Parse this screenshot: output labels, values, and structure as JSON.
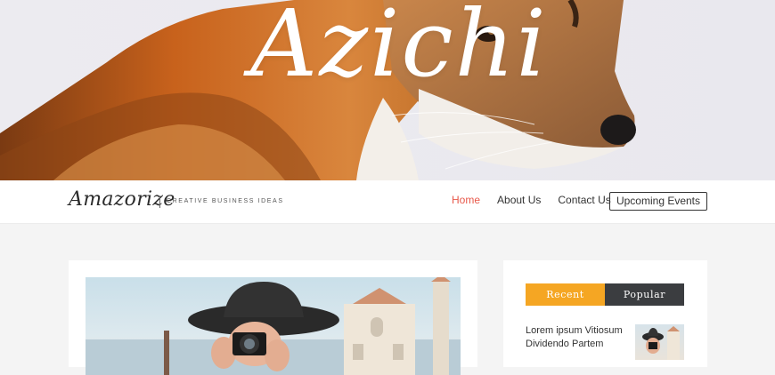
{
  "hero": {
    "title": "Azichi"
  },
  "brand": {
    "logo": "Amazorize",
    "tagline": "CREATIVE BUSINESS IDEAS"
  },
  "nav": {
    "items": [
      {
        "label": "Home",
        "active": true
      },
      {
        "label": "About Us",
        "active": false
      },
      {
        "label": "Contact Us",
        "active": false
      }
    ],
    "cta_label": "Upcoming Events"
  },
  "sidebar": {
    "tabs": [
      {
        "label": "Recent"
      },
      {
        "label": "Popular"
      }
    ],
    "posts": [
      {
        "title": "Lorem ipsum Vitiosum Dividendo Partem"
      }
    ]
  },
  "colors": {
    "accent": "#e8584a",
    "tab_recent": "#f5a623",
    "tab_popular": "#3b3d40"
  }
}
